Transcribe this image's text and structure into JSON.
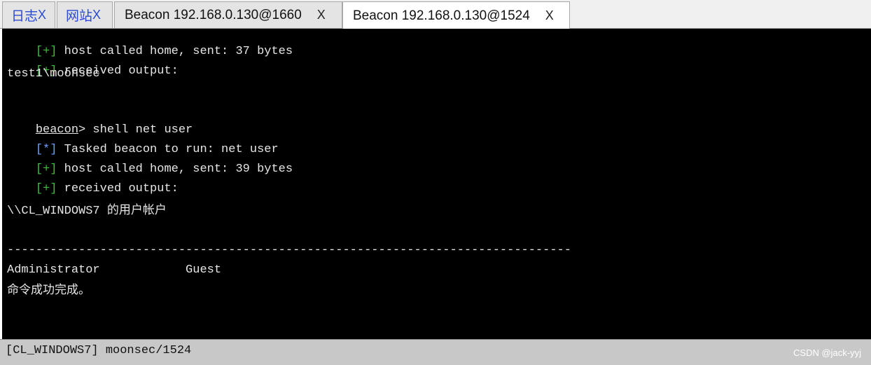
{
  "tabs": [
    {
      "label": "日志",
      "close": "X"
    },
    {
      "label": "网站",
      "close": "X"
    },
    {
      "label": "Beacon 192.168.0.130@1660",
      "close": "X"
    },
    {
      "label": "Beacon 192.168.0.130@1524",
      "close": "X",
      "active": true
    }
  ],
  "console": {
    "lines": [
      {
        "mark": "[+]",
        "text": " host called home, sent: 37 bytes"
      },
      {
        "mark": "[+]",
        "text": " received output:"
      },
      {
        "text": "test1\\moonsec"
      },
      {
        "prompt": "beacon",
        "text": "> shell net user"
      },
      {
        "mark": "[*]",
        "text": " Tasked beacon to run: net user"
      },
      {
        "mark": "[+]",
        "text": " host called home, sent: 39 bytes"
      },
      {
        "mark": "[+]",
        "text": " received output:"
      },
      {
        "text": "\\\\CL_WINDOWS7 的用户帐户"
      },
      {
        "text": "-------------------------------------------------------------------------------"
      },
      {
        "text": "Administrator            Guest"
      },
      {
        "text": "命令成功完成。"
      }
    ]
  },
  "status": {
    "text": "[CL_WINDOWS7] moonsec/1524",
    "watermark": "CSDN @jack-yyj"
  },
  "colors": {
    "console_bg": "#000000",
    "plus_mark": "#3cbf3c",
    "star_mark": "#6aa0ff",
    "small_tab_text": "#2a4bd0"
  }
}
